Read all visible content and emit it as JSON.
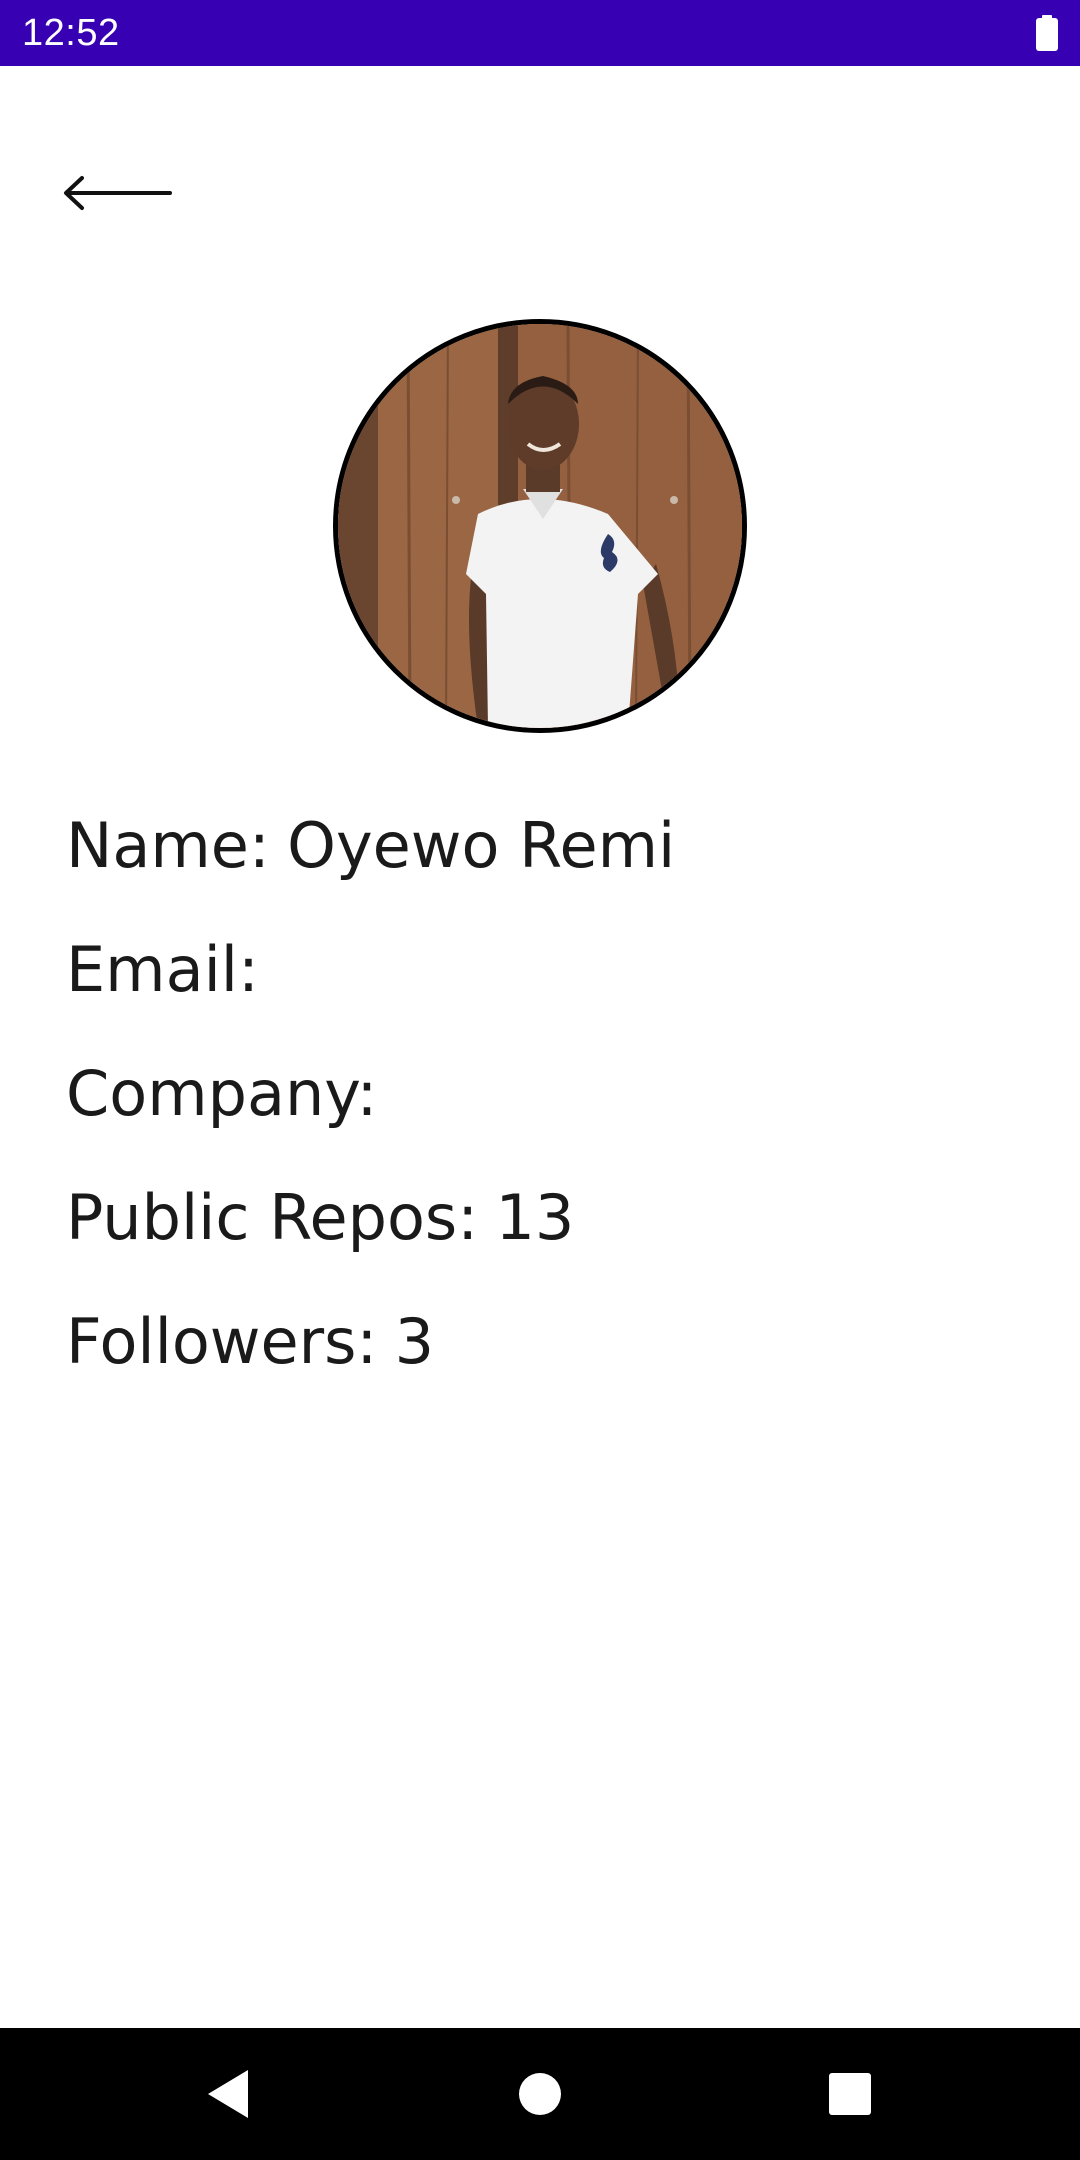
{
  "status_bar": {
    "time": "12:52",
    "battery_icon": "battery-full-icon",
    "background": "#3700b3"
  },
  "toolbar": {
    "back_icon": "arrow-left-icon"
  },
  "profile": {
    "avatar": "profile-photo",
    "fields": {
      "name": {
        "label": "Name:",
        "value": "Oyewo Remi"
      },
      "email": {
        "label": "Email:",
        "value": ""
      },
      "company": {
        "label": "Company:",
        "value": ""
      },
      "public_repos": {
        "label": "Public Repos:",
        "value": "13"
      },
      "followers": {
        "label": "Followers:",
        "value": "3"
      }
    }
  },
  "nav_bar": {
    "back_icon": "triangle-back-icon",
    "home_icon": "circle-home-icon",
    "recents_icon": "square-recents-icon"
  }
}
